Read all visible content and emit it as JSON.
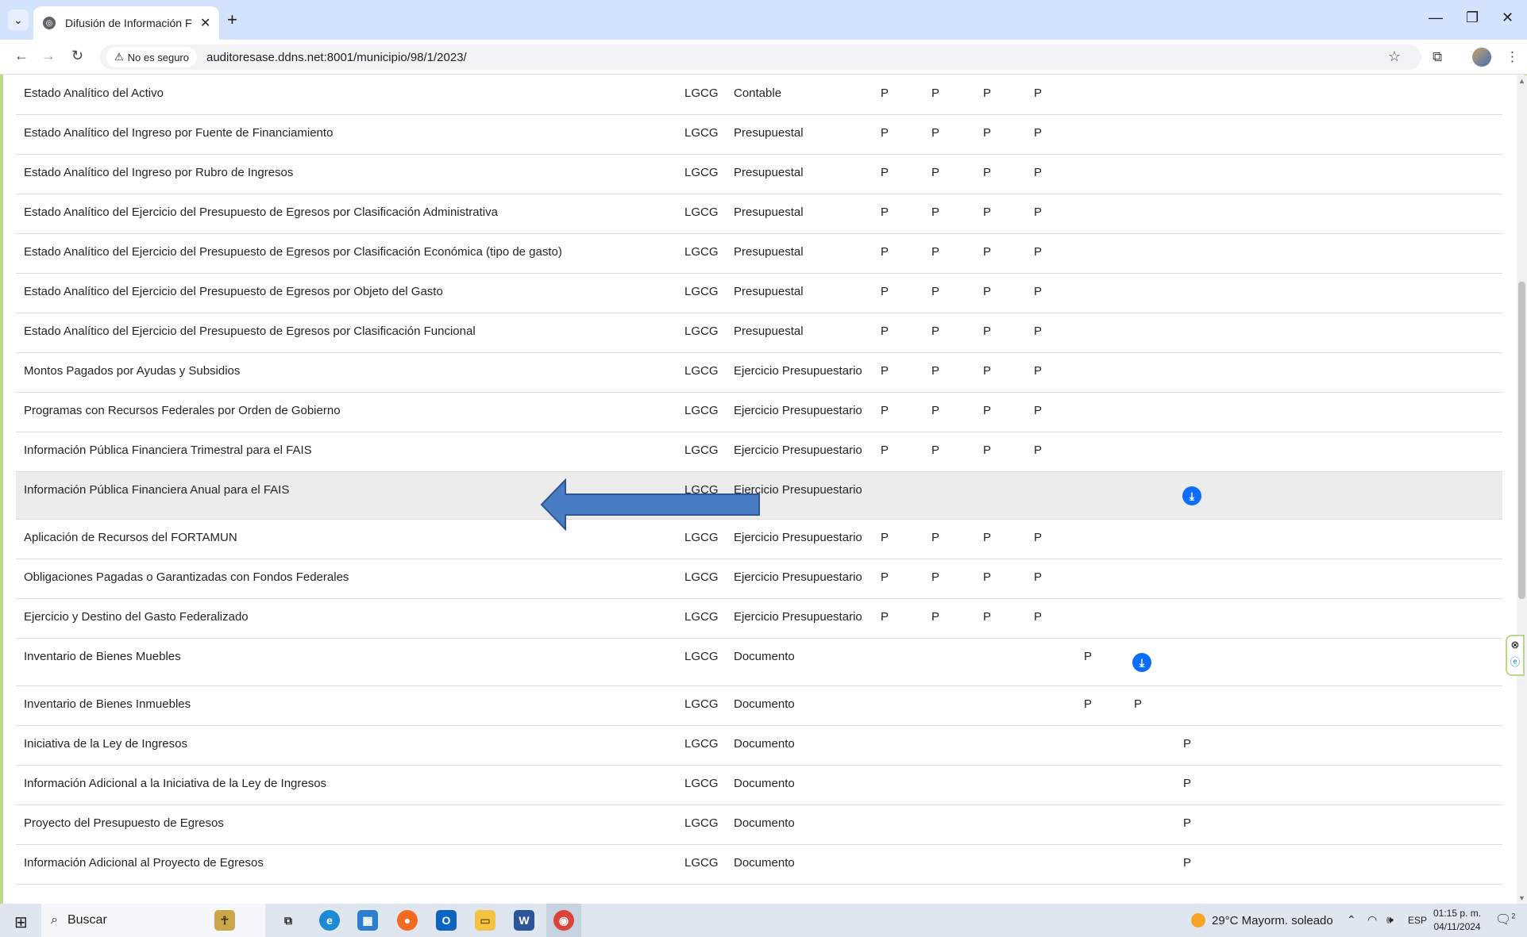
{
  "browser": {
    "tab_title": "Difusión de Información Financ",
    "security_label": "No es seguro",
    "url": "auditoresase.ddns.net:8001/municipio/98/1/2023/"
  },
  "rows": [
    {
      "name": "Estado Analítico del Activo",
      "law": "LGCG",
      "type": "Contable",
      "marks": [
        "P",
        "P",
        "P",
        "P",
        "",
        "",
        ""
      ],
      "download": ""
    },
    {
      "name": "Estado Analítico del Ingreso por Fuente de Financiamiento",
      "law": "LGCG",
      "type": "Presupuestal",
      "marks": [
        "P",
        "P",
        "P",
        "P",
        "",
        "",
        ""
      ],
      "download": ""
    },
    {
      "name": "Estado Analítico del Ingreso por Rubro de Ingresos",
      "law": "LGCG",
      "type": "Presupuestal",
      "marks": [
        "P",
        "P",
        "P",
        "P",
        "",
        "",
        ""
      ],
      "download": ""
    },
    {
      "name": "Estado Analítico del Ejercicio del Presupuesto de Egresos por Clasificación Administrativa",
      "law": "LGCG",
      "type": "Presupuestal",
      "marks": [
        "P",
        "P",
        "P",
        "P",
        "",
        "",
        ""
      ],
      "download": ""
    },
    {
      "name": "Estado Analítico del Ejercicio del Presupuesto de Egresos por Clasificación Económica (tipo de gasto)",
      "law": "LGCG",
      "type": "Presupuestal",
      "marks": [
        "P",
        "P",
        "P",
        "P",
        "",
        "",
        ""
      ],
      "download": ""
    },
    {
      "name": "Estado Analítico del Ejercicio del Presupuesto de Egresos por Objeto del Gasto",
      "law": "LGCG",
      "type": "Presupuestal",
      "marks": [
        "P",
        "P",
        "P",
        "P",
        "",
        "",
        ""
      ],
      "download": ""
    },
    {
      "name": "Estado Analítico del Ejercicio del Presupuesto de Egresos por Clasificación Funcional",
      "law": "LGCG",
      "type": "Presupuestal",
      "marks": [
        "P",
        "P",
        "P",
        "P",
        "",
        "",
        ""
      ],
      "download": ""
    },
    {
      "name": "Montos Pagados por Ayudas y Subsidios",
      "law": "LGCG",
      "type": "Ejercicio Presupuestario",
      "marks": [
        "P",
        "P",
        "P",
        "P",
        "",
        "",
        ""
      ],
      "download": ""
    },
    {
      "name": "Programas con Recursos Federales por Orden de Gobierno",
      "law": "LGCG",
      "type": "Ejercicio Presupuestario",
      "marks": [
        "P",
        "P",
        "P",
        "P",
        "",
        "",
        ""
      ],
      "download": ""
    },
    {
      "name": "Información Pública Financiera Trimestral para el FAIS",
      "law": "LGCG",
      "type": "Ejercicio Presupuestario",
      "marks": [
        "P",
        "P",
        "P",
        "P",
        "",
        "",
        ""
      ],
      "download": ""
    },
    {
      "name": "Información Pública Financiera Anual para el FAIS",
      "law": "LGCG",
      "type": "Ejercicio Presupuestario",
      "marks": [
        "",
        "",
        "",
        "",
        "",
        "",
        ""
      ],
      "download": "c7"
    },
    {
      "name": "Aplicación de Recursos del FORTAMUN",
      "law": "LGCG",
      "type": "Ejercicio Presupuestario",
      "marks": [
        "P",
        "P",
        "P",
        "P",
        "",
        "",
        ""
      ],
      "download": ""
    },
    {
      "name": "Obligaciones Pagadas o Garantizadas con Fondos Federales",
      "law": "LGCG",
      "type": "Ejercicio Presupuestario",
      "marks": [
        "P",
        "P",
        "P",
        "P",
        "",
        "",
        ""
      ],
      "download": ""
    },
    {
      "name": "Ejercicio y Destino del Gasto Federalizado",
      "law": "LGCG",
      "type": "Ejercicio Presupuestario",
      "marks": [
        "P",
        "P",
        "P",
        "P",
        "",
        "",
        ""
      ],
      "download": ""
    },
    {
      "name": "Inventario de Bienes Muebles",
      "law": "LGCG",
      "type": "Documento",
      "marks": [
        "",
        "",
        "",
        "",
        "P",
        "",
        ""
      ],
      "download": "c6"
    },
    {
      "name": "Inventario de Bienes Inmuebles",
      "law": "LGCG",
      "type": "Documento",
      "marks": [
        "",
        "",
        "",
        "",
        "P",
        "P",
        ""
      ],
      "download": ""
    },
    {
      "name": "Iniciativa de la Ley de Ingresos",
      "law": "LGCG",
      "type": "Documento",
      "marks": [
        "",
        "",
        "",
        "",
        "",
        "",
        "P"
      ],
      "download": ""
    },
    {
      "name": "Información Adicional a la Iniciativa de la Ley de Ingresos",
      "law": "LGCG",
      "type": "Documento",
      "marks": [
        "",
        "",
        "",
        "",
        "",
        "",
        "P"
      ],
      "download": ""
    },
    {
      "name": "Proyecto del Presupuesto de Egresos",
      "law": "LGCG",
      "type": "Documento",
      "marks": [
        "",
        "",
        "",
        "",
        "",
        "",
        "P"
      ],
      "download": ""
    },
    {
      "name": "Información Adicional al Proyecto de Egresos",
      "law": "LGCG",
      "type": "Documento",
      "marks": [
        "",
        "",
        "",
        "",
        "",
        "",
        "P"
      ],
      "download": ""
    }
  ],
  "taskbar": {
    "search_placeholder": "Buscar",
    "weather": "29°C  Mayorm. soleado",
    "language": "ESP",
    "time": "01:15 p. m.",
    "date": "04/11/2024",
    "notification_count": "2"
  }
}
